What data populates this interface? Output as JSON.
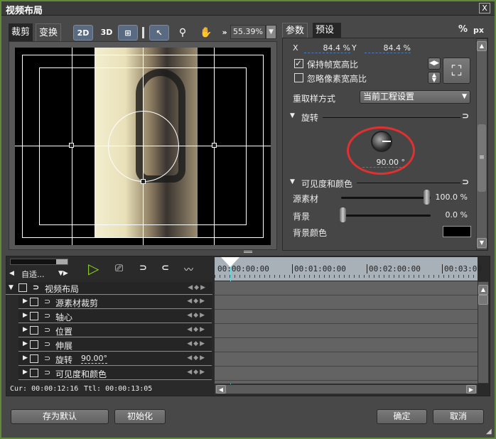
{
  "window": {
    "title": "视频布局",
    "close": "X"
  },
  "left_tabs": [
    "裁剪",
    "变换"
  ],
  "toolbar": {
    "btn_2d": "2D",
    "btn_3d": "3D",
    "zoom_value": "55.39%",
    "icons": [
      "2d-mode-icon",
      "3d-mode-icon",
      "grid-icon",
      "select-arrow-icon",
      "magnifier-icon",
      "hand-icon",
      "more-icon",
      "dropdown-icon"
    ]
  },
  "right_tabs": [
    "参数",
    "预设"
  ],
  "units": {
    "percent": "%",
    "px": "px"
  },
  "params": {
    "x_label": "X",
    "x_value": "84.4 %",
    "y_label": "Y",
    "y_value": "84.4 %",
    "keep_aspect": {
      "label": "保持帧宽高比",
      "checked": true
    },
    "ignore_pixel_aspect": {
      "label": "忽略像素宽高比",
      "checked": false
    },
    "resample_label": "重取样方式",
    "resample_value": "当前工程设置",
    "rotation_section": "旋转",
    "rotation_value": "90.00 °",
    "visibility_section": "可见度和颜色",
    "source_label": "源素材",
    "source_value": "100.0 %",
    "source_level": 1.0,
    "bg_label": "背景",
    "bg_value": "0.0 %",
    "bg_level": 0.0,
    "bg_color_label": "背景颜色",
    "bg_color": "#000000",
    "highlight_color": "#e03030"
  },
  "timeline": {
    "zoom_label": "自适...",
    "ruler": [
      "00:00:00:00",
      "00:01:00:00",
      "00:02:00:00",
      "00:03:00"
    ],
    "tracks": [
      {
        "name": "视频布局",
        "expanded": true
      },
      {
        "name": "源素材裁剪"
      },
      {
        "name": "轴心"
      },
      {
        "name": "位置"
      },
      {
        "name": "伸展"
      },
      {
        "name": "旋转",
        "value": "90.00°"
      },
      {
        "name": "可见度和颜色"
      }
    ],
    "cur": "Cur: 00:00:12:16",
    "ttl": "Ttl: 00:00:13:05"
  },
  "buttons": {
    "save_default": "存为默认",
    "init": "初始化",
    "ok": "确定",
    "cancel": "取消"
  }
}
